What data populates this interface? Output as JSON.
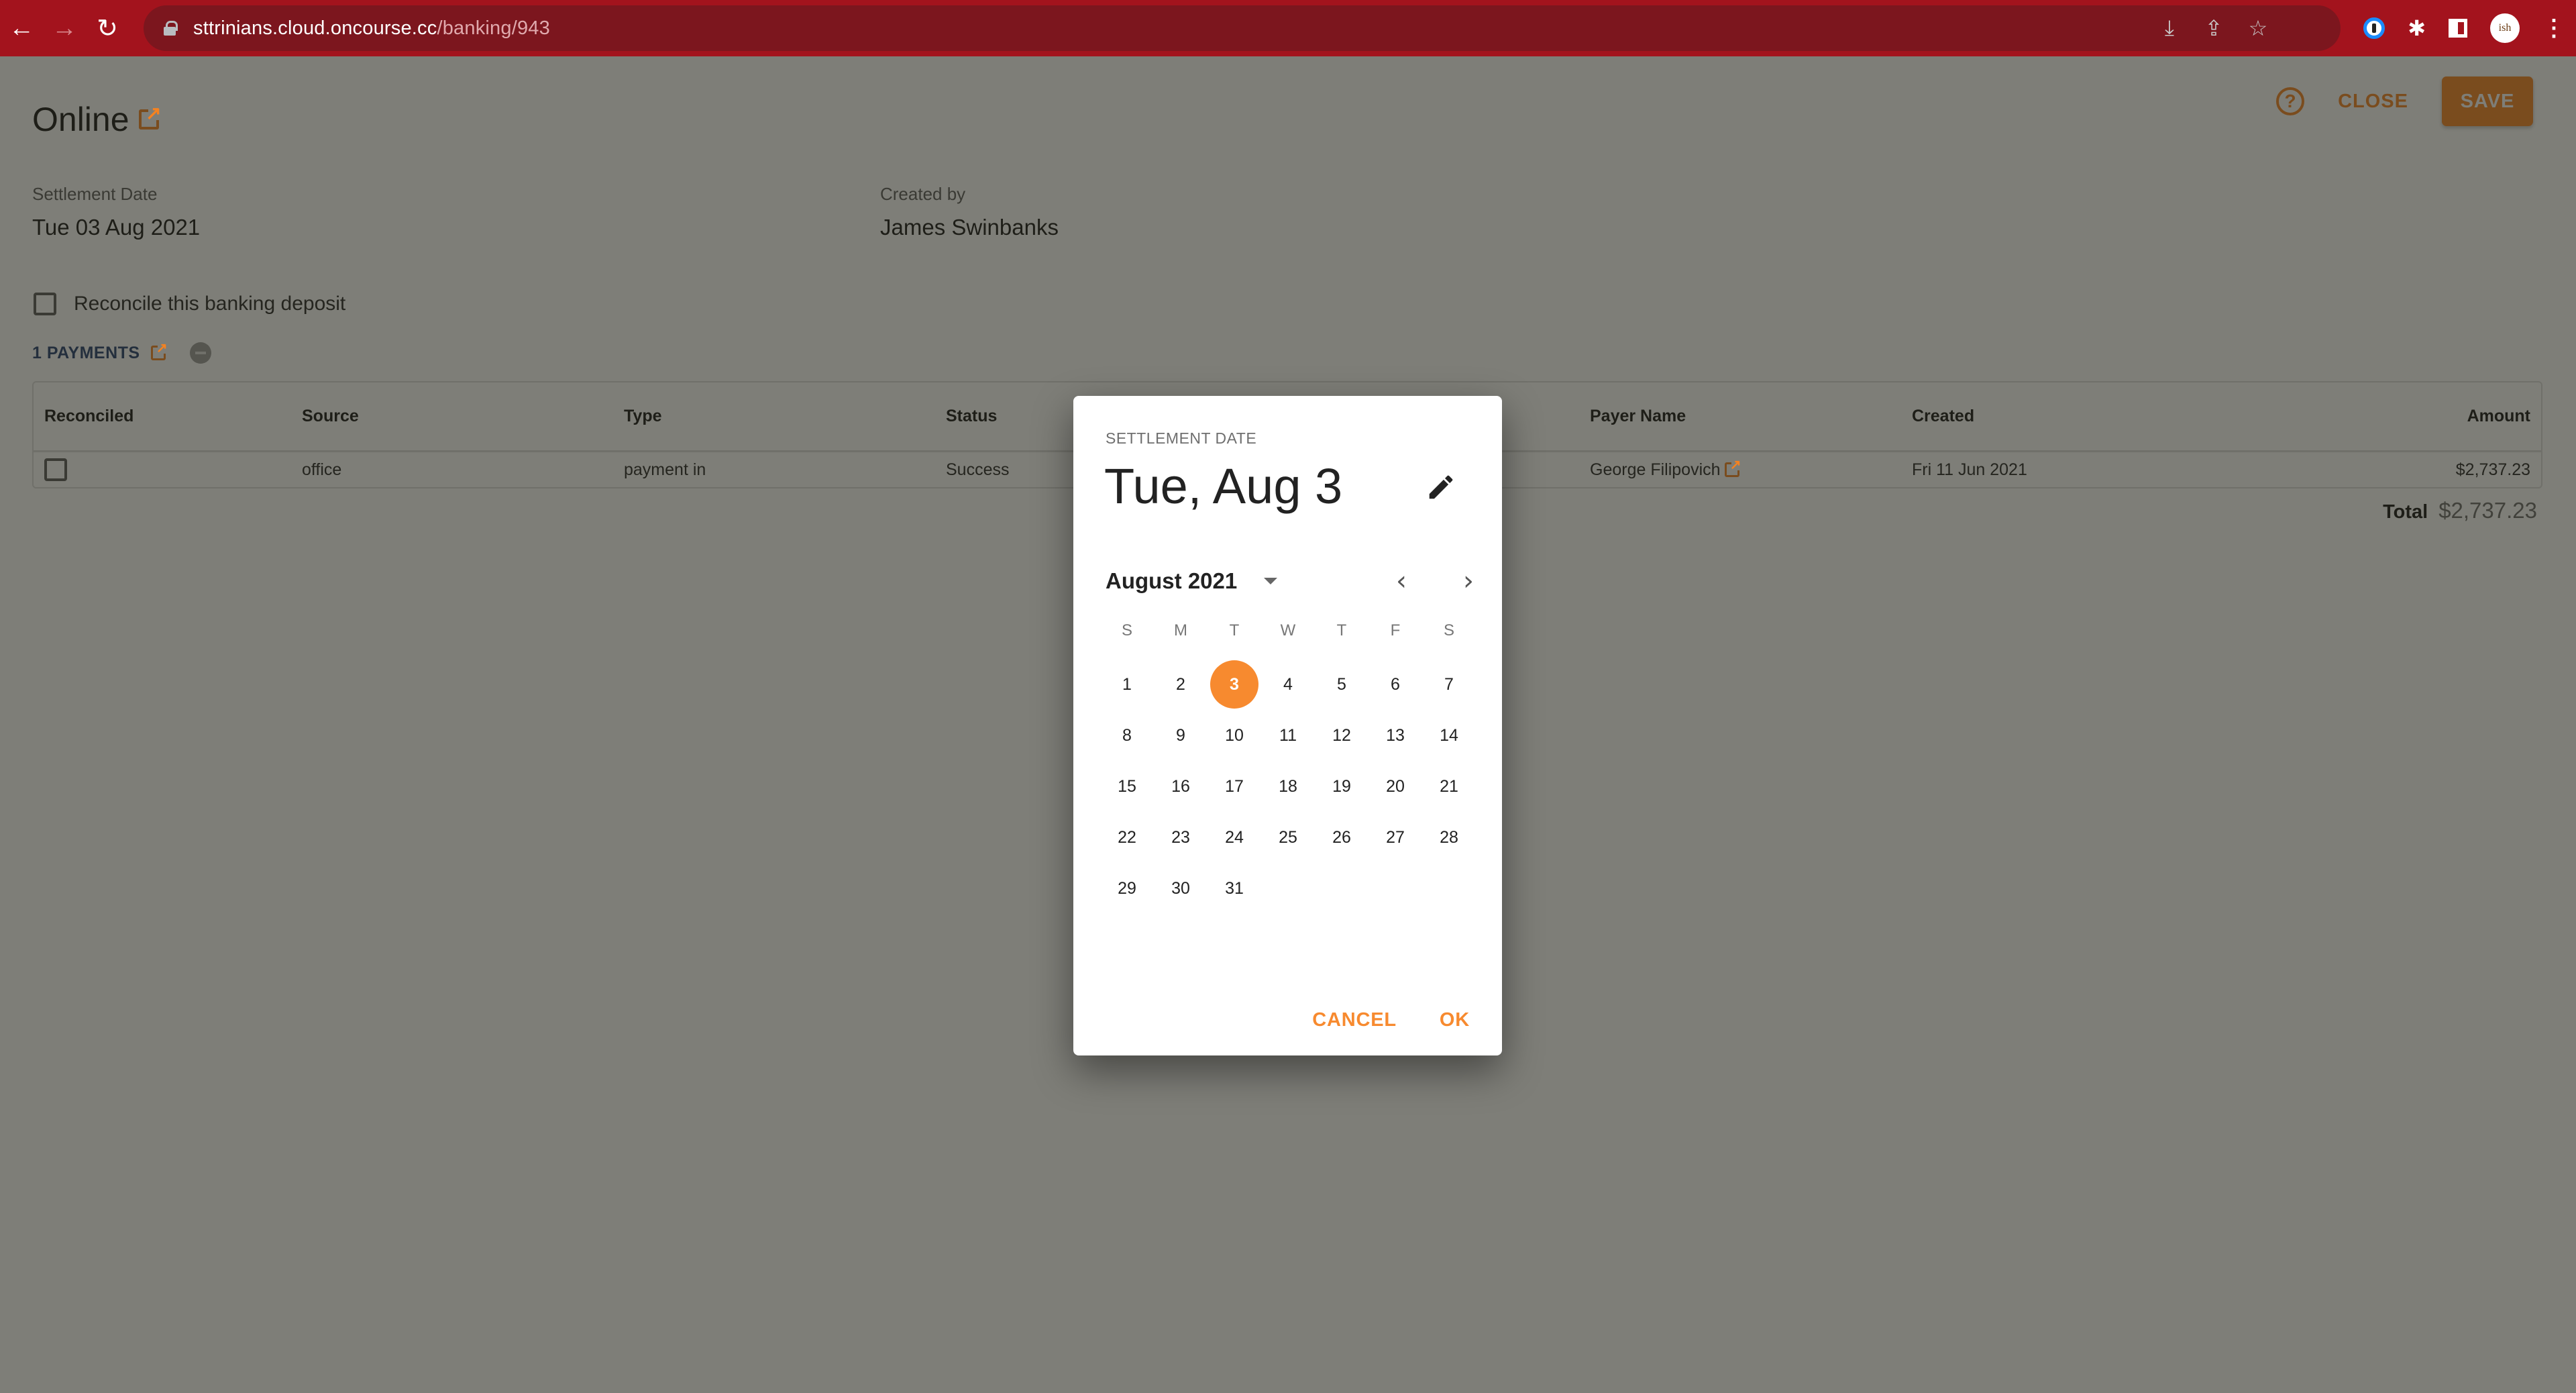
{
  "browser": {
    "url_host": "sttrinians.cloud.oncourse.cc",
    "url_path": "/banking/943",
    "back_icon": "arrow-left-icon",
    "forward_icon": "arrow-right-icon",
    "reload_icon": "reload-icon",
    "profile_label": "ish",
    "glyphs": {
      "back": "←",
      "forward": "→",
      "reload": "↻",
      "install": "⤓",
      "share": "⇪",
      "star": "☆",
      "puzzle": "✱",
      "menu": "⋮"
    }
  },
  "header": {
    "title": "Online",
    "help_glyph": "?",
    "close_label": "CLOSE",
    "save_label": "SAVE"
  },
  "fields": {
    "settlement_date_label": "Settlement Date",
    "settlement_date_value": "Tue 03 Aug 2021",
    "created_by_label": "Created by",
    "created_by_value": "James Swinbanks"
  },
  "reconcile": {
    "label": "Reconcile this banking deposit",
    "checked": false
  },
  "payments": {
    "label": "1 PAYMENTS",
    "columns": [
      "Reconciled",
      "Source",
      "Type",
      "Status",
      "Payer Name",
      "Created",
      "Amount"
    ],
    "rows": [
      {
        "reconciled": false,
        "source": "office",
        "type": "payment in",
        "status": "Success",
        "payer_name": "George Filipovich",
        "created": "Fri 11 Jun 2021",
        "amount": "$2,737.23"
      }
    ],
    "total_label": "Total",
    "total_value": "$2,737.23"
  },
  "dialog": {
    "overline": "SETTLEMENT DATE",
    "selected_date_display": "Tue, Aug 3",
    "month_label": "August 2021",
    "prev_glyph": "‹",
    "next_glyph": "›",
    "weekdays": [
      "S",
      "M",
      "T",
      "W",
      "T",
      "F",
      "S"
    ],
    "first_weekday_offset": 0,
    "days_in_month": 31,
    "selected_day": 3,
    "cancel_label": "CANCEL",
    "ok_label": "OK"
  },
  "colors": {
    "accent": "#f58220",
    "browser_bar": "#a3131d",
    "payments_label": "#1f3b6b"
  }
}
